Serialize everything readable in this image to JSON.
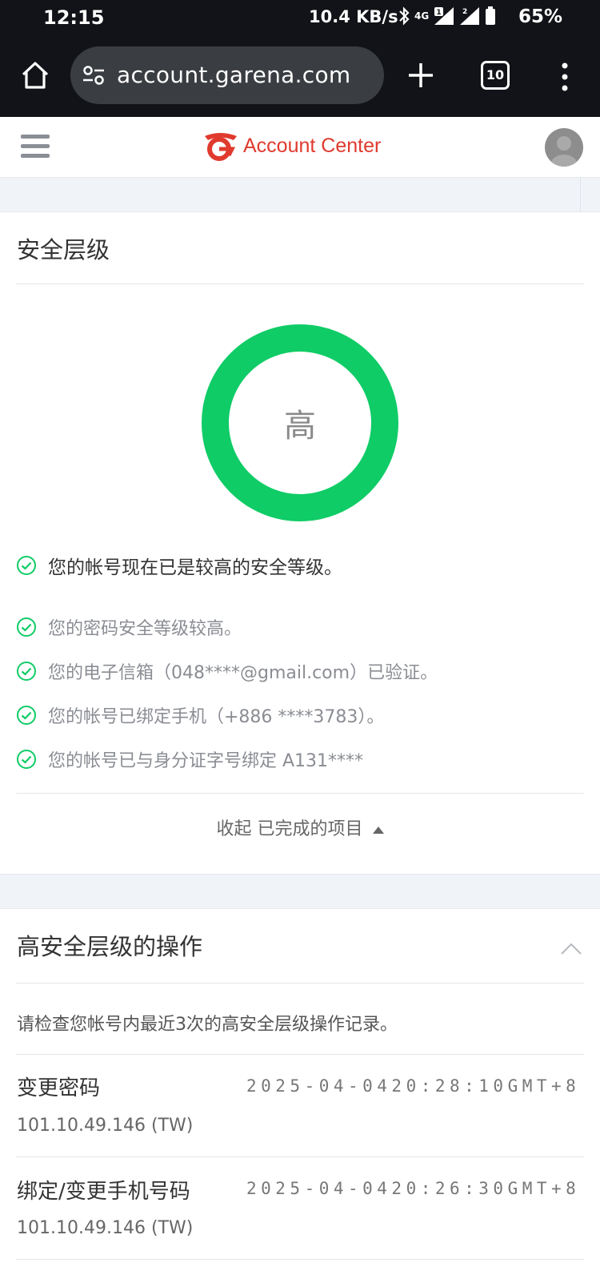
{
  "status_bar": {
    "time": "12:15",
    "net_speed": "10.4 KB/s",
    "network_type": "4G",
    "sim1_badge": "1",
    "sim2_badge": "2",
    "battery": "65%"
  },
  "browser": {
    "url": "account.garena.com",
    "tab_count": "10"
  },
  "header": {
    "brand": "Account Center",
    "brand_color": "#e03a2e"
  },
  "security": {
    "title": "安全层级",
    "level": "高",
    "ring_color": "#0fcc66",
    "summary": "您的帐号现在已是较高的安全等级。",
    "checks": [
      "您的密码安全等级较高。",
      "您的电子信箱（048****@gmail.com）已验证。",
      "您的帐号已绑定手机（+886 ****3783）。",
      "您的帐号已与身分证字号绑定 A131****"
    ],
    "collapse_label": "收起 已完成的项目"
  },
  "operations": {
    "title": "高安全层级的操作",
    "description": "请检查您帐号内最近3次的高安全层级操作记录。",
    "records": [
      {
        "action": "变更密码",
        "time": "2025-04-0420:28:10GMT+8",
        "ip": "101.10.49.146 (TW)"
      },
      {
        "action": "绑定/变更手机号码",
        "time": "2025-04-0420:26:30GMT+8",
        "ip": "101.10.49.146 (TW)"
      }
    ]
  }
}
